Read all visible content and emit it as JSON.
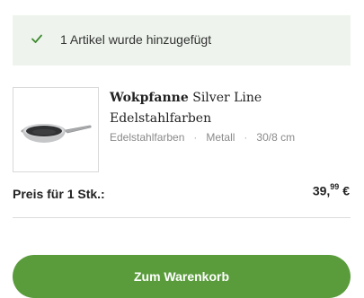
{
  "notice": {
    "message": "1 Artikel wurde hinzugefügt",
    "icon": "check-icon"
  },
  "product": {
    "brand": "Wokpfanne",
    "name": "Silver Line Edelstahlfarben",
    "image_icon": "wok-pan-image",
    "attributes": [
      "Edelstahlfarben",
      "Metall",
      "30/8 cm"
    ]
  },
  "price": {
    "label": "Preis für 1 Stk.:",
    "euros": "39,",
    "cents": "99",
    "currency": "€"
  },
  "cta": {
    "label": "Zum Warenkorb"
  },
  "colors": {
    "accent": "#5a9c3c",
    "notice_bg": "#eef4ed",
    "check": "#3d8a2e"
  }
}
